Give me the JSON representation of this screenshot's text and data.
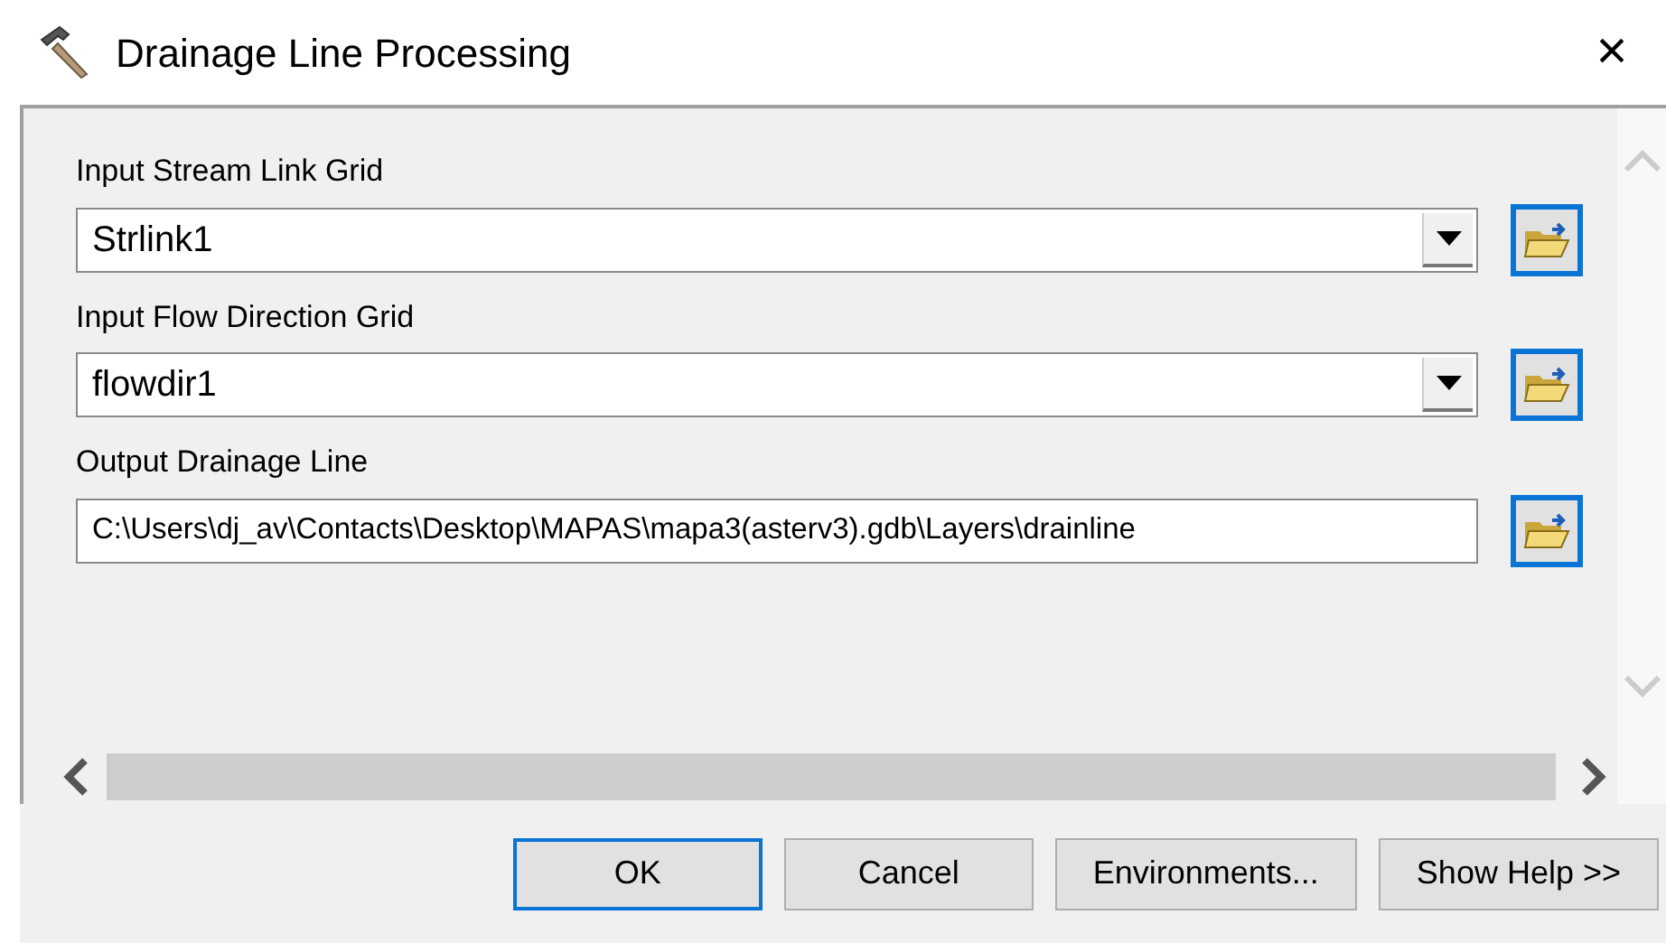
{
  "window": {
    "title": "Drainage Line Processing",
    "close": "×"
  },
  "parameters": [
    {
      "label": "Input Stream Link Grid",
      "kind": "combo",
      "value": "Strlink1"
    },
    {
      "label": "Input Flow Direction Grid",
      "kind": "combo",
      "value": "flowdir1"
    },
    {
      "label": "Output Drainage Line",
      "kind": "text",
      "value": "C:\\Users\\dj_av\\Contacts\\Desktop\\MAPAS\\mapa3(asterv3).gdb\\Layers\\drainline"
    }
  ],
  "buttons": [
    {
      "label": "OK",
      "default": true
    },
    {
      "label": "Cancel",
      "default": false
    },
    {
      "label": "Environments...",
      "default": false
    },
    {
      "label": "Show Help >>",
      "default": false
    }
  ]
}
